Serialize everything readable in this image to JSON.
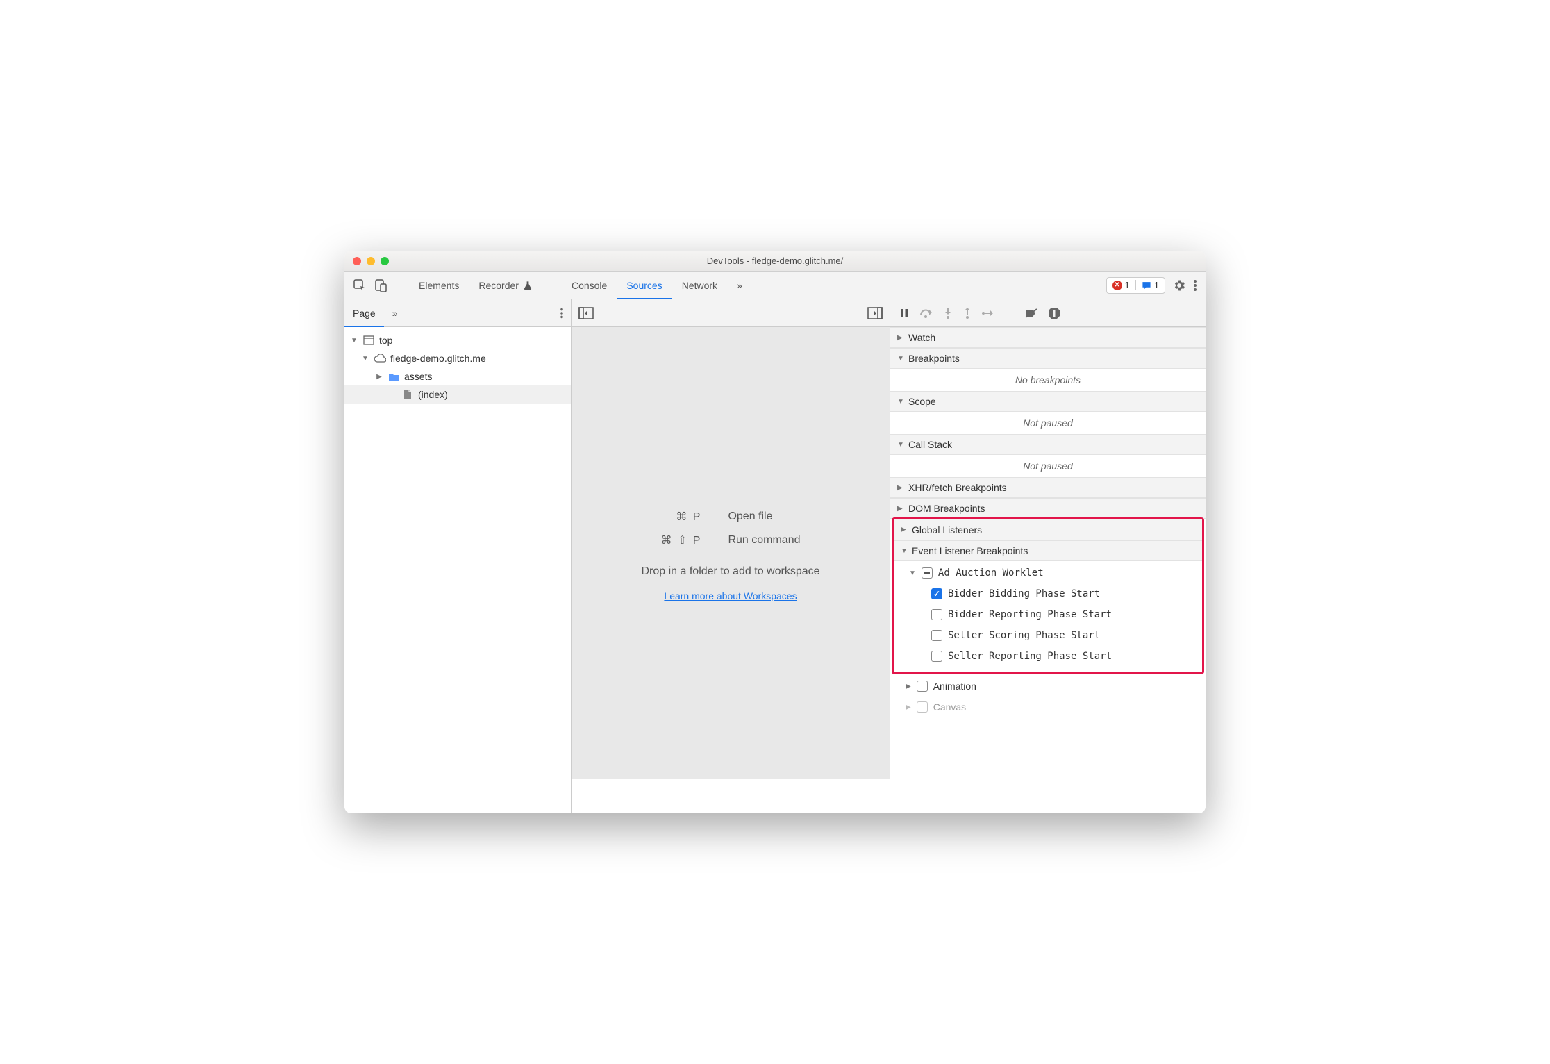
{
  "window": {
    "title": "DevTools - fledge-demo.glitch.me/"
  },
  "tabs": {
    "items": [
      "Elements",
      "Recorder",
      "Console",
      "Sources",
      "Network"
    ],
    "active_index": 3
  },
  "badges": {
    "errors": "1",
    "messages": "1"
  },
  "sidebar": {
    "page_tab": "Page",
    "tree": {
      "top": "top",
      "domain": "fledge-demo.glitch.me",
      "folder": "assets",
      "file": "(index)"
    }
  },
  "middle": {
    "open_file_shortcut": "⌘ P",
    "open_file_label": "Open file",
    "run_cmd_shortcut": "⌘ ⇧ P",
    "run_cmd_label": "Run command",
    "workspace_hint": "Drop in a folder to add to workspace",
    "workspace_link": "Learn more about Workspaces"
  },
  "right": {
    "watch": "Watch",
    "breakpoints": "Breakpoints",
    "no_breakpoints": "No breakpoints",
    "scope": "Scope",
    "not_paused": "Not paused",
    "callstack": "Call Stack",
    "xhr": "XHR/fetch Breakpoints",
    "dom": "DOM Breakpoints",
    "global_listeners": "Global Listeners",
    "elb": "Event Listener Breakpoints",
    "ad_auction": "Ad Auction Worklet",
    "events": [
      "Bidder Bidding Phase Start",
      "Bidder Reporting Phase Start",
      "Seller Scoring Phase Start",
      "Seller Reporting Phase Start"
    ],
    "animation": "Animation",
    "canvas": "Canvas"
  }
}
